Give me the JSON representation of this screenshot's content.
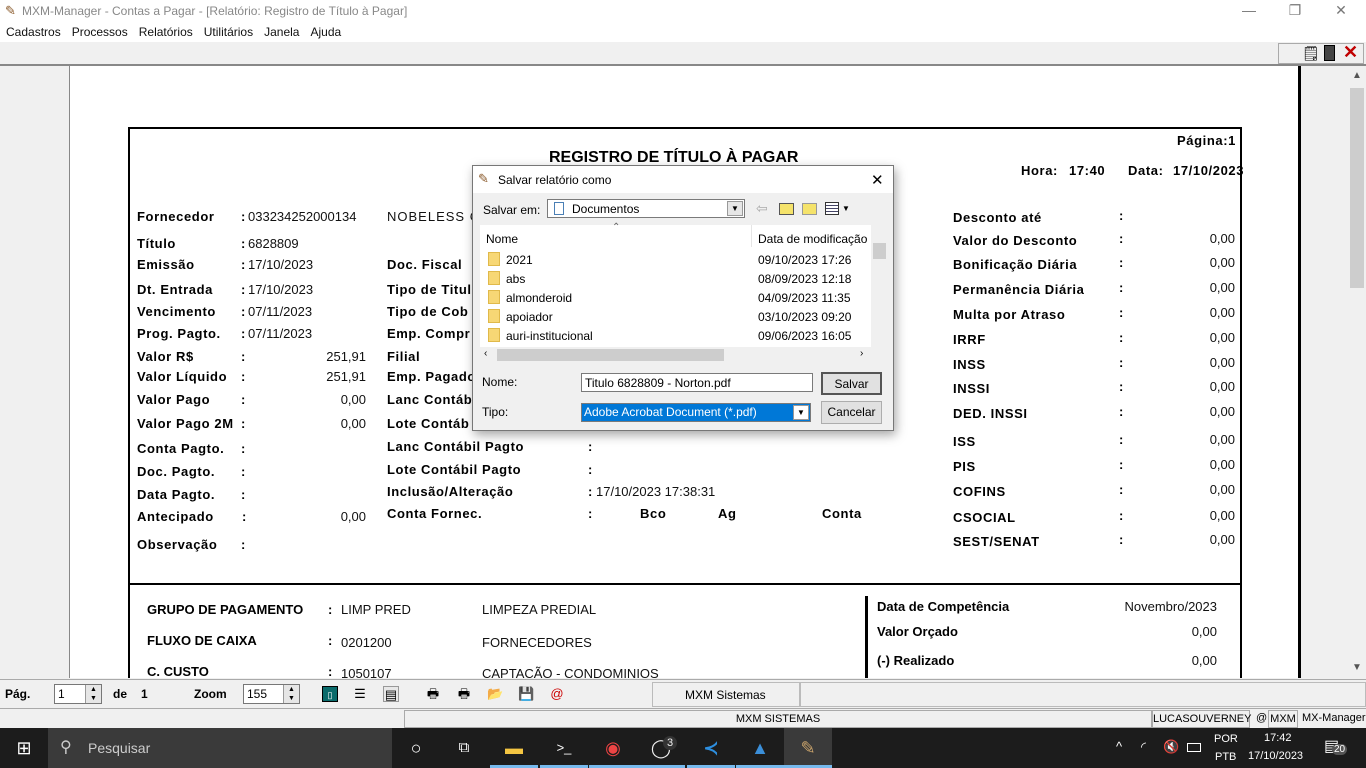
{
  "window": {
    "title": "MXM-Manager  -  Contas a Pagar - [Relatório: Registro de Título à Pagar]",
    "minimize": "—",
    "restore": "❐",
    "close": "✕"
  },
  "menu": [
    "Cadastros",
    "Processos",
    "Relatórios",
    "Utilitários",
    "Janela",
    "Ajuda"
  ],
  "toolbar_icons": [
    "notepad-icon",
    "calculator-icon",
    "close-report-icon"
  ],
  "report": {
    "title": "REGISTRO DE TÍTULO À PAGAR",
    "page_label": "Página:1",
    "hora_label": "Hora:",
    "hora": "17:40",
    "data_label": "Data:",
    "data": "17/10/2023",
    "fornecedor_name": "NOBELESS C",
    "left": [
      {
        "label": "Fornecedor",
        "value": "033234252000134"
      },
      {
        "label": "Título",
        "value": "6828809"
      },
      {
        "label": "Emissão",
        "value": "17/10/2023"
      },
      {
        "label": "Dt. Entrada",
        "value": "17/10/2023"
      },
      {
        "label": "Vencimento",
        "value": "07/11/2023"
      },
      {
        "label": "Prog. Pagto.",
        "value": "07/11/2023"
      },
      {
        "label": "Valor R$",
        "value": "251,91",
        "num": true
      },
      {
        "label": "Valor Líquido",
        "value": "251,91",
        "num": true
      },
      {
        "label": "Valor Pago",
        "value": "0,00",
        "num": true
      },
      {
        "label": "Valor Pago 2M",
        "value": "0,00",
        "num": true
      },
      {
        "label": "Conta Pagto.",
        "value": ""
      },
      {
        "label": "Doc. Pagto.",
        "value": ""
      },
      {
        "label": "Data Pagto.",
        "value": ""
      },
      {
        "label": "Antecipado",
        "value": "0,00",
        "num": true
      },
      {
        "label": "Observação",
        "value": ""
      }
    ],
    "middle": [
      {
        "label": "Doc. Fiscal",
        "value": ""
      },
      {
        "label": "Tipo de Titul",
        "value": ""
      },
      {
        "label": "Tipo de Cob",
        "value": ""
      },
      {
        "label": "Emp. Compr",
        "value": ""
      },
      {
        "label": "Filial",
        "value": ""
      },
      {
        "label": "Emp. Pagado",
        "value": ""
      },
      {
        "label": "Lanc Contáb",
        "value": ""
      },
      {
        "label": "Lote  Contáb",
        "value": ""
      },
      {
        "label": "Lanc Contábil Pagto",
        "value": ""
      },
      {
        "label": "Lote  Contábil Pagto",
        "value": ""
      },
      {
        "label": "Inclusão/Alteração",
        "value": "17/10/2023 17:38:31"
      },
      {
        "label": "Conta Fornec.",
        "value": ""
      }
    ],
    "conta_fornec": {
      "bco": "Bco",
      "ag": "Ag",
      "conta": "Conta"
    },
    "right": [
      {
        "label": "Desconto até",
        "value": ""
      },
      {
        "label": "Valor do Desconto",
        "value": "0,00"
      },
      {
        "label": "Bonificação Diária",
        "value": "0,00"
      },
      {
        "label": "Permanência Diária",
        "value": "0,00"
      },
      {
        "label": "Multa por Atraso",
        "value": "0,00"
      },
      {
        "label": "IRRF",
        "value": "0,00"
      },
      {
        "label": "INSS",
        "value": "0,00"
      },
      {
        "label": "INSSI",
        "value": "0,00"
      },
      {
        "label": "DED. INSSI",
        "value": "0,00"
      },
      {
        "label": "ISS",
        "value": "0,00"
      },
      {
        "label": "PIS",
        "value": "0,00"
      },
      {
        "label": "COFINS",
        "value": "0,00"
      },
      {
        "label": "CSOCIAL",
        "value": "0,00"
      },
      {
        "label": "SEST/SENAT",
        "value": "0,00"
      }
    ],
    "bottom_left": [
      {
        "label": "GRUPO DE PAGAMENTO",
        "code": "LIMP PRED",
        "desc": "LIMPEZA PREDIAL"
      },
      {
        "label": "FLUXO DE CAIXA",
        "code": "0201200",
        "desc": "FORNECEDORES"
      },
      {
        "label": "C. CUSTO",
        "code": "1050107",
        "desc": "CAPTAÇÃO - CONDOMINIOS"
      }
    ],
    "bottom_right": [
      {
        "label": "Data de Competência",
        "value": "Novembro/2023"
      },
      {
        "label": "Valor Orçado",
        "value": "0,00"
      },
      {
        "label": "(-) Realizado",
        "value": "0,00"
      }
    ]
  },
  "dialog": {
    "title": "Salvar relatório como",
    "save_in_label": "Salvar em:",
    "save_in_value": "Documentos",
    "columns": [
      "Nome",
      "Data de modificação"
    ],
    "files": [
      {
        "name": "2021",
        "date": "09/10/2023 17:26"
      },
      {
        "name": "abs",
        "date": "08/09/2023 12:18"
      },
      {
        "name": "almonderoid",
        "date": "04/09/2023 11:35"
      },
      {
        "name": "apoiador",
        "date": "03/10/2023 09:20"
      },
      {
        "name": "auri-institucional",
        "date": "09/06/2023 16:05"
      }
    ],
    "name_label": "Nome:",
    "name_value": "Titulo 6828809 - Norton.pdf",
    "type_label": "Tipo:",
    "type_value": "Adobe Acrobat Document (*.pdf)",
    "save_button": "Salvar",
    "cancel_button": "Cancelar",
    "close": "✕"
  },
  "bottom_toolbar": {
    "page_label": "Pág.",
    "page_value": "1",
    "of_label": "de",
    "of_value": "1",
    "zoom_label": "Zoom",
    "zoom_value": "155",
    "company": "MXM Sistemas"
  },
  "statusbar": {
    "center": "MXM SISTEMAS",
    "user": "LUCASOUVERNEY",
    "at": "@",
    "company": "MXM",
    "app": "MX-Manager"
  },
  "taskbar": {
    "search_placeholder": "Pesquisar",
    "lang1": "POR",
    "lang2": "PTB",
    "time": "17:42",
    "date": "17/10/2023",
    "notifications": "20",
    "whatsapp_badge": "3"
  },
  "colors": {
    "selection": "#0078d7",
    "taskbar": "#1c1c1c",
    "close_red": "#c00000"
  }
}
